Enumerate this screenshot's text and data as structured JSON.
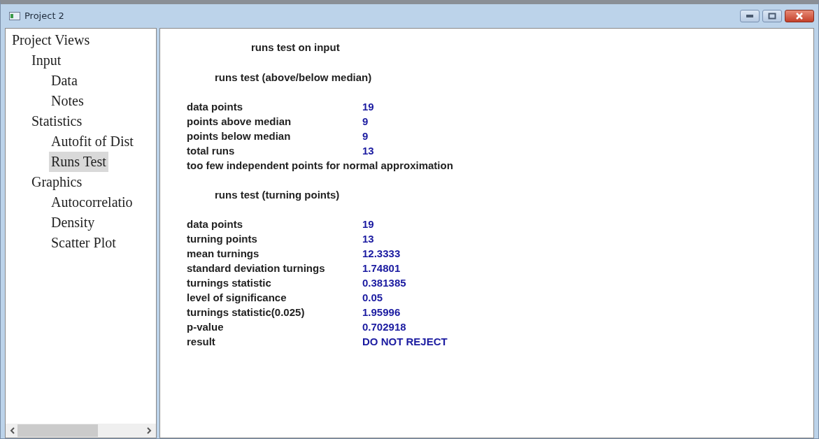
{
  "window": {
    "title": "Project 2"
  },
  "tree": {
    "label": "Project Views",
    "selected": false,
    "children": [
      {
        "label": "Input",
        "selected": false,
        "children": [
          {
            "label": "Data",
            "selected": false
          },
          {
            "label": "Notes",
            "selected": false
          }
        ]
      },
      {
        "label": "Statistics",
        "selected": false,
        "children": [
          {
            "label": "Autofit of Dist",
            "selected": false
          },
          {
            "label": "Runs Test",
            "selected": true
          }
        ]
      },
      {
        "label": "Graphics",
        "selected": false,
        "children": [
          {
            "label": "Autocorrelatio",
            "selected": false
          },
          {
            "label": "Density",
            "selected": false
          },
          {
            "label": "Scatter Plot",
            "selected": false
          }
        ]
      }
    ]
  },
  "output": [
    {
      "kind": "title",
      "text": "runs test on input"
    },
    {
      "kind": "heading",
      "text": "runs test (above/below median)"
    },
    {
      "kind": "row",
      "label": "data points",
      "value": "19"
    },
    {
      "kind": "row",
      "label": "points above median",
      "value": "9"
    },
    {
      "kind": "row",
      "label": "points below median",
      "value": "9"
    },
    {
      "kind": "row",
      "label": "total runs",
      "value": "13"
    },
    {
      "kind": "note",
      "text": "too few independent points for normal approximation"
    },
    {
      "kind": "heading",
      "text": "runs test (turning points)"
    },
    {
      "kind": "row",
      "label": "data points",
      "value": "19"
    },
    {
      "kind": "row",
      "label": "turning points",
      "value": "13"
    },
    {
      "kind": "row",
      "label": "mean turnings",
      "value": "12.3333"
    },
    {
      "kind": "row",
      "label": "standard deviation turnings",
      "value": "1.74801"
    },
    {
      "kind": "row",
      "label": "turnings statistic",
      "value": "0.381385"
    },
    {
      "kind": "row",
      "label": "level of significance",
      "value": "0.05"
    },
    {
      "kind": "row",
      "label": "turnings statistic(0.025)",
      "value": "1.95996"
    },
    {
      "kind": "row",
      "label": "p-value",
      "value": "0.702918"
    },
    {
      "kind": "row",
      "label": "result",
      "value": "DO NOT REJECT"
    }
  ]
}
